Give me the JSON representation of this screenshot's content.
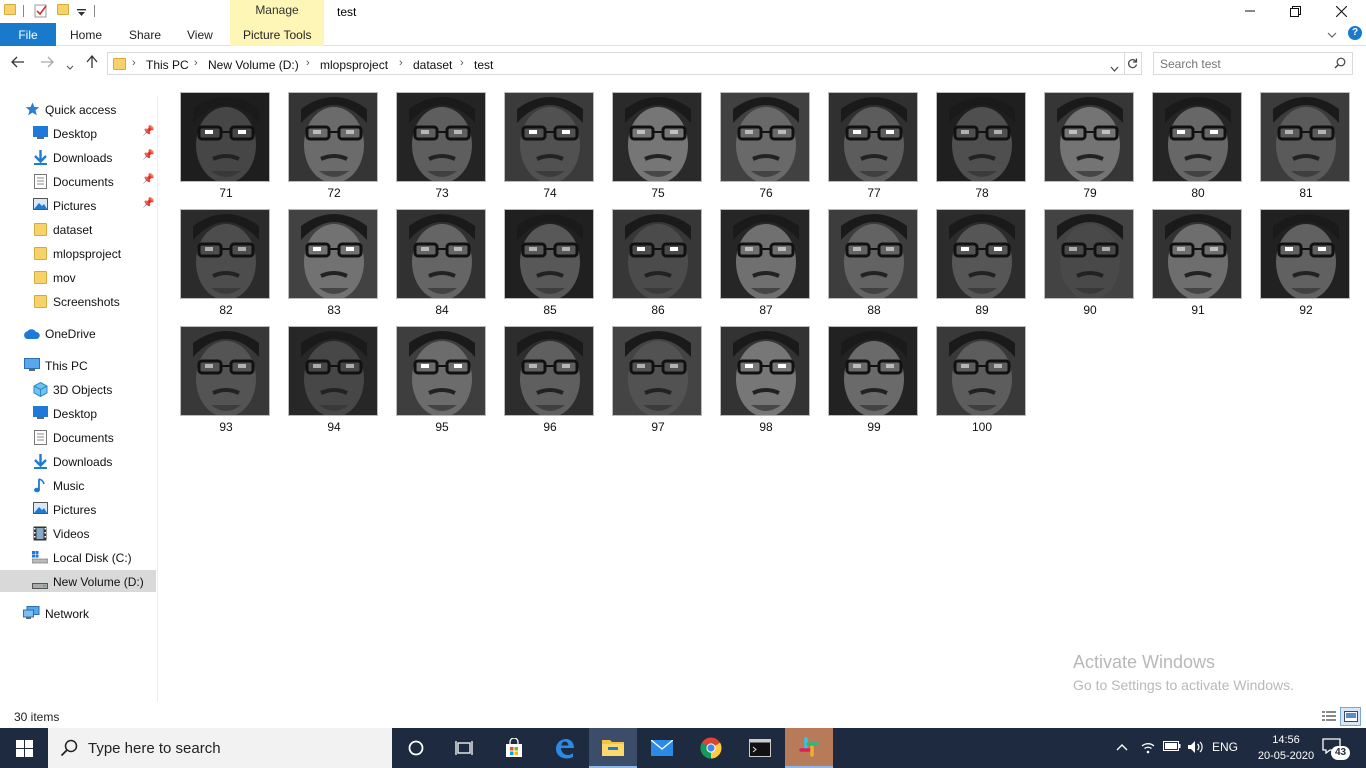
{
  "window": {
    "title": "test",
    "manage_tab": "Manage"
  },
  "ribbon": {
    "file": "File",
    "home": "Home",
    "share": "Share",
    "view": "View",
    "picture_tools": "Picture Tools"
  },
  "address": {
    "crumbs": [
      "This PC",
      "New Volume (D:)",
      "mlopsproject",
      "dataset",
      "test"
    ]
  },
  "search": {
    "placeholder": "Search test"
  },
  "nav": {
    "quick_access": "Quick access",
    "qa_items": [
      "Desktop",
      "Downloads",
      "Documents",
      "Pictures",
      "dataset",
      "mlopsproject",
      "mov",
      "Screenshots"
    ],
    "onedrive": "OneDrive",
    "this_pc": "This PC",
    "pc_items": [
      "3D Objects",
      "Desktop",
      "Documents",
      "Downloads",
      "Music",
      "Pictures",
      "Videos",
      "Local Disk (C:)",
      "New Volume (D:)"
    ],
    "network": "Network"
  },
  "files": [
    "71",
    "72",
    "73",
    "74",
    "75",
    "76",
    "77",
    "78",
    "79",
    "80",
    "81",
    "82",
    "83",
    "84",
    "85",
    "86",
    "87",
    "88",
    "89",
    "90",
    "91",
    "92",
    "93",
    "94",
    "95",
    "96",
    "97",
    "98",
    "99",
    "100"
  ],
  "status": {
    "items": "30 items"
  },
  "watermark": {
    "title": "Activate Windows",
    "subtitle": "Go to Settings to activate Windows."
  },
  "taskbar": {
    "search_text": "Type here to search",
    "language": "ENG",
    "time": "14:56",
    "date": "20-05-2020",
    "notifications": "43"
  },
  "colors": {
    "file_tab": "#1979ca",
    "picture_tools": "#fdf6b6",
    "taskbar": "#1d2a3f",
    "selected_nav": "#d9d9d9"
  }
}
